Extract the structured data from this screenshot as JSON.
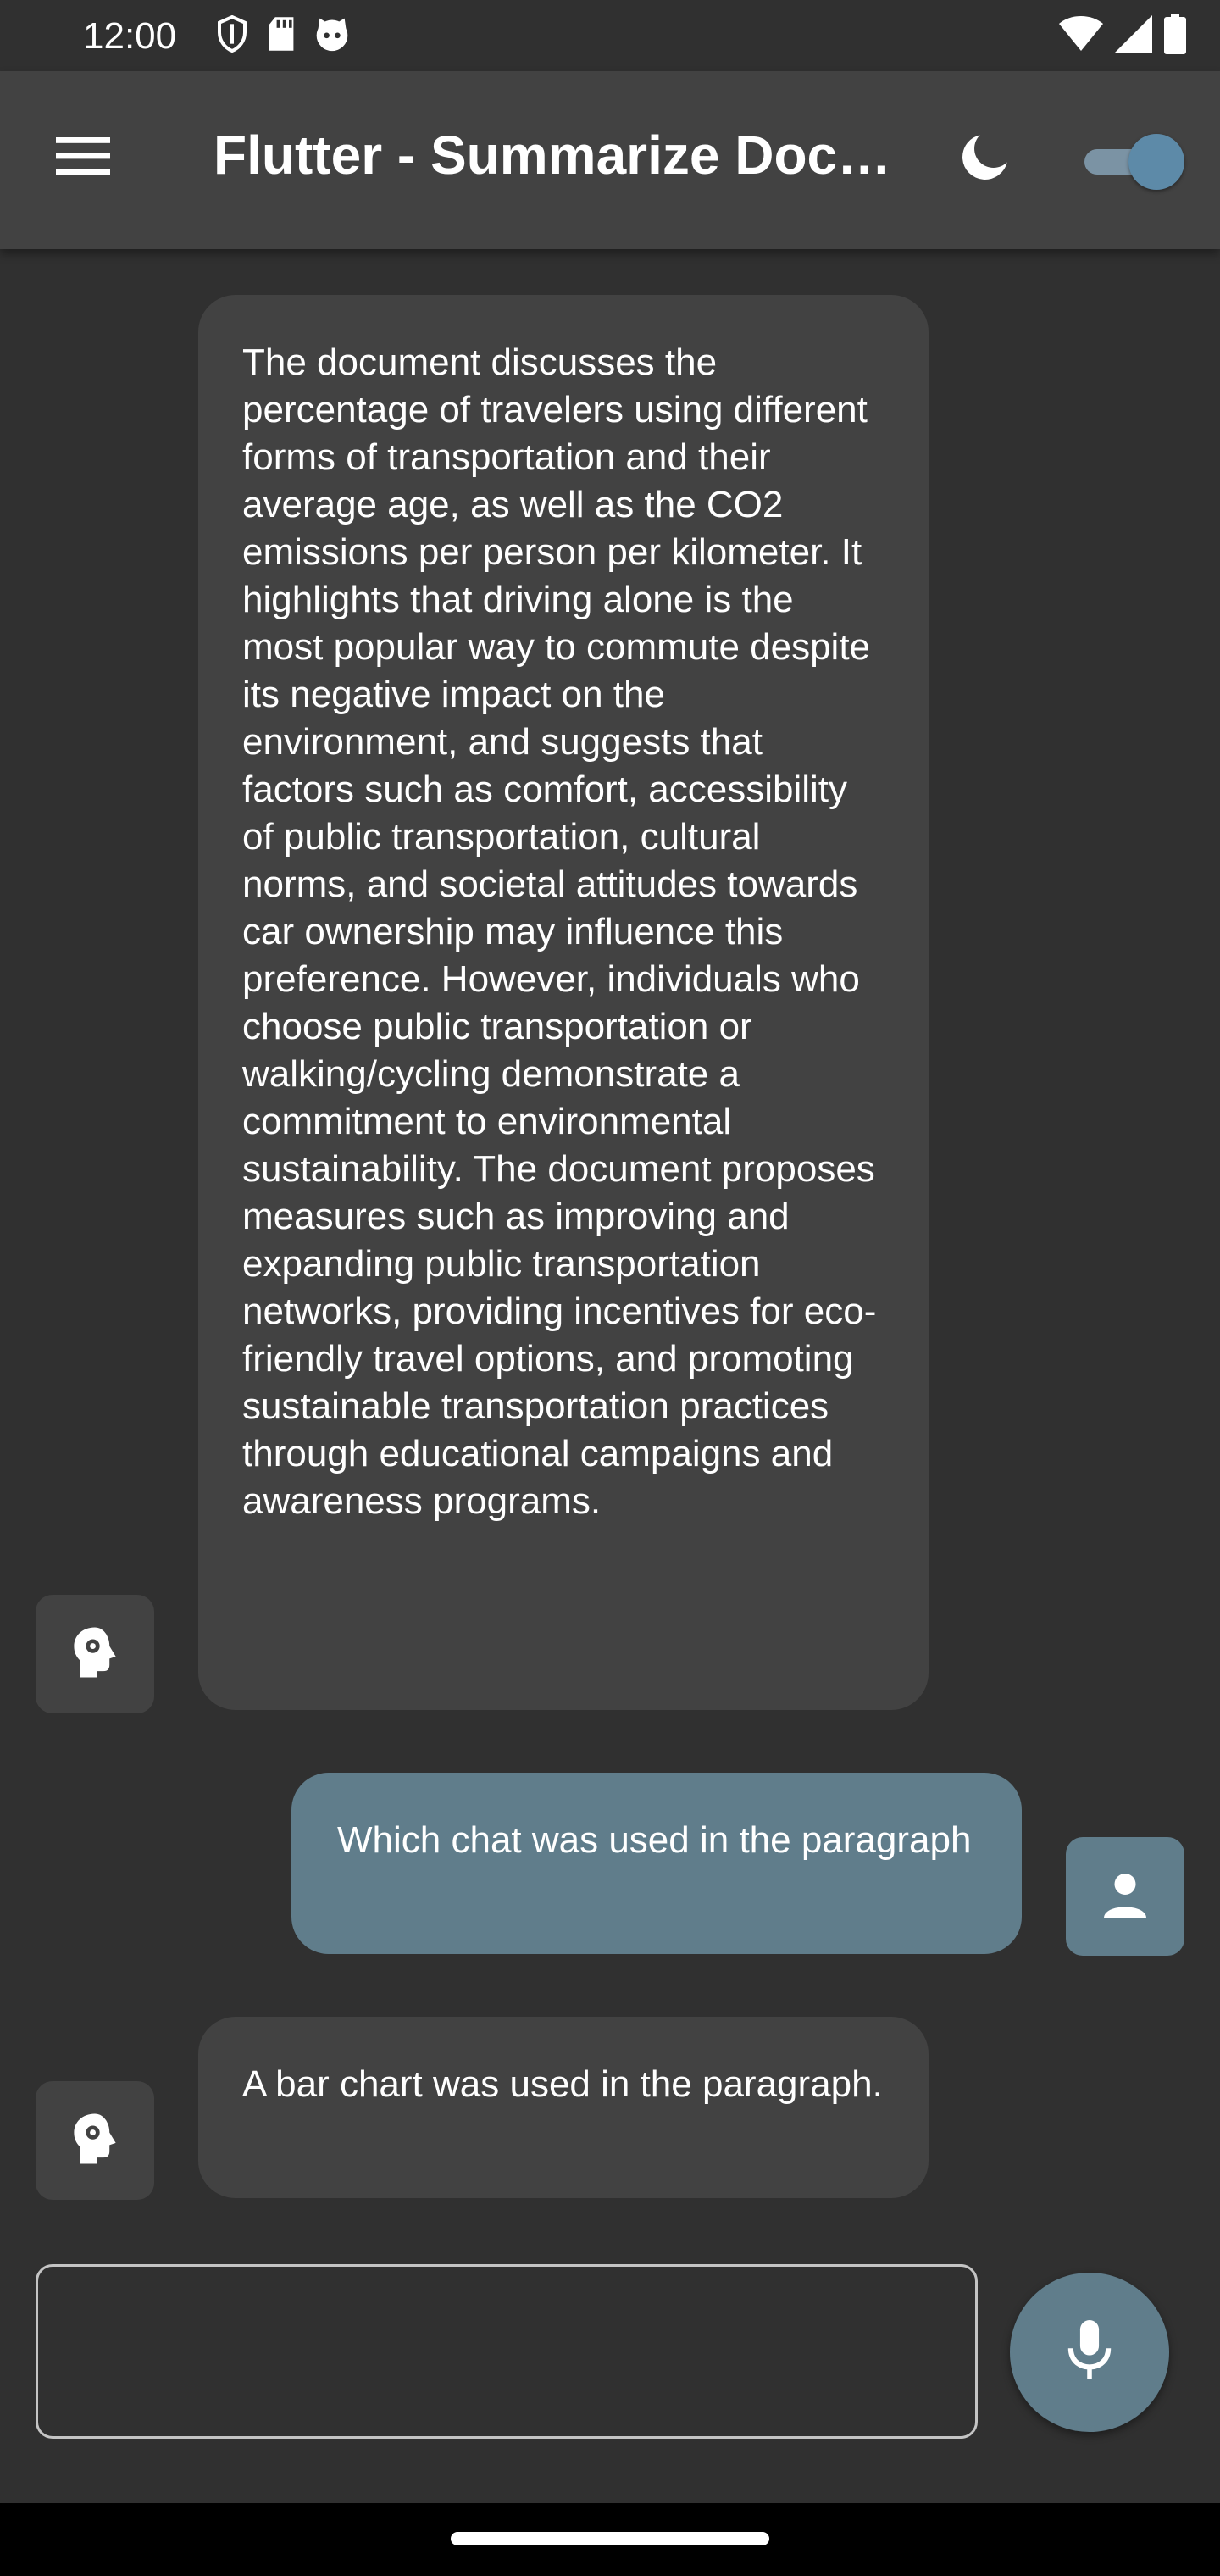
{
  "status_bar": {
    "time": "12:00",
    "left_icons": [
      "shield-icon",
      "sd-card-icon",
      "cat-face-icon"
    ],
    "right_icons": [
      "wifi-icon",
      "signal-icon",
      "battery-icon"
    ]
  },
  "app_bar": {
    "title": "Flutter - Summarize Document",
    "menu_icon": "hamburger-menu-icon",
    "theme_icon": "moon-icon",
    "dark_mode_switch_on": true
  },
  "messages": [
    {
      "sender": "bot",
      "text": "The document discusses the percentage of travelers using different forms of transportation and their average age, as well as the CO2 emissions per person per kilometer. It highlights that driving alone is the most popular way to commute despite its negative impact on the environment, and suggests that factors such as comfort, accessibility of public transportation, cultural norms, and societal attitudes towards car ownership may influence this preference. However, individuals who choose public transportation or walking/cycling demonstrate a commitment to environmental sustainability. The document proposes measures such as improving and expanding public transportation networks, providing incentives for eco-friendly travel options, and promoting sustainable transportation practices through educational campaigns and awareness programs.",
      "avatar_icon": "psychology-head-icon"
    },
    {
      "sender": "user",
      "text": "Which chat was used in the paragraph",
      "avatar_icon": "person-icon"
    },
    {
      "sender": "bot",
      "text": "A bar chart was used in the paragraph.",
      "avatar_icon": "psychology-head-icon"
    }
  ],
  "composer": {
    "value": "",
    "placeholder": "",
    "mic_icon": "microphone-icon"
  },
  "colors": {
    "background": "#303030",
    "app_bar": "#424242",
    "bot_bubble": "#424242",
    "user_bubble": "#607d8b",
    "accent": "#5d8aa8"
  }
}
